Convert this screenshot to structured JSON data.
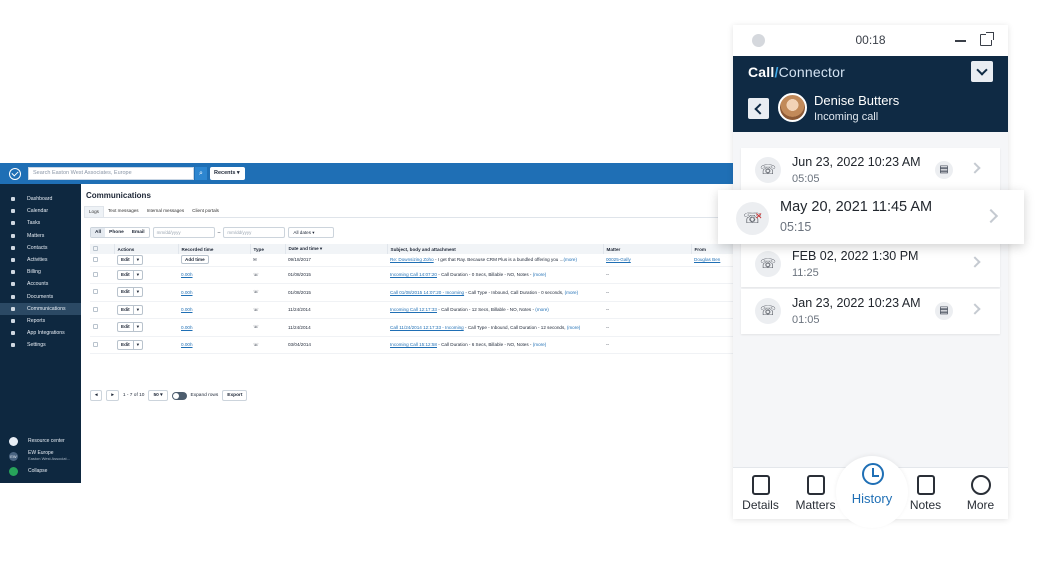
{
  "app": {
    "search_placeholder": "Search Easton West Associates, Europe",
    "recents_label": "Recents ▾",
    "sidebar": [
      {
        "label": "Dashboard"
      },
      {
        "label": "Calendar"
      },
      {
        "label": "Tasks"
      },
      {
        "label": "Matters"
      },
      {
        "label": "Contacts"
      },
      {
        "label": "Activities"
      },
      {
        "label": "Billing"
      },
      {
        "label": "Accounts"
      },
      {
        "label": "Documents"
      },
      {
        "label": "Communications",
        "active": true
      },
      {
        "label": "Reports"
      },
      {
        "label": "App Integrations"
      },
      {
        "label": "Settings"
      }
    ],
    "sidebar_bottom": {
      "resource_center": "Resource center",
      "org_initials": "EW",
      "org_name": "EW Europe",
      "org_sub": "Easton West Associat...",
      "collapse": "Collapse"
    },
    "page_title": "Communications",
    "tabs": [
      "Logs",
      "Text messages",
      "Internal messages",
      "Client portals"
    ],
    "filters": {
      "all": "All",
      "phone": "Phone",
      "email": "Email",
      "date_placeholder": "mm/dd/yyyy",
      "dash": "–",
      "dates_select": "All dates ▾"
    },
    "columns": [
      "Actions",
      "Recorded time",
      "Type",
      "Date and time ▾",
      "Subject, body and attachment",
      "Matter",
      "From"
    ],
    "rows": [
      {
        "action": "Edit",
        "recorded": "Add time",
        "type": "✉",
        "date": "09/18/2017",
        "subject_link": "Re: Downsizing Zoho",
        "subject_text": " - I get that Ray. Because CRM Plus is a bundled offering you ...",
        "more": "(more)",
        "matter": "00025-Gally",
        "from": "Douglas Ben"
      },
      {
        "action": "Edit",
        "recorded": "0.00h",
        "type": "☏",
        "date": "01/08/2015",
        "subject_link": "Incoming Call 14:07:20",
        "subject_text": " - Call Duration - 0 Secs, Billable - NO, Notes - ",
        "more": "(more)",
        "matter": "--",
        "from": ""
      },
      {
        "action": "Edit",
        "recorded": "0.00h",
        "type": "☏",
        "date": "01/08/2015",
        "subject_link": "Call 01/08/2015 14:07:20 - Incoming",
        "subject_text": " - Call Type - Inbound, Call Duration - 0 seconds, ",
        "more": "(more)",
        "matter": "--",
        "from": ""
      },
      {
        "action": "Edit",
        "recorded": "0.00h",
        "type": "☏",
        "date": "11/24/2014",
        "subject_link": "Incoming Call 12:17:33",
        "subject_text": " - Call Duration - 12 Secs, Billable - NO, Notes - ",
        "more": "(more)",
        "matter": "--",
        "from": ""
      },
      {
        "action": "Edit",
        "recorded": "0.00h",
        "type": "☏",
        "date": "11/24/2014",
        "subject_link": "Call 11/24/2014 12:17:33 - Incoming",
        "subject_text": " - Call Type - Inbound, Call Duration - 12 seconds, ",
        "more": "(more)",
        "matter": "--",
        "from": ""
      },
      {
        "action": "Edit",
        "recorded": "0.00h",
        "type": "☏",
        "date": "03/04/2014",
        "subject_link": "Incoming Call 15:12:58",
        "subject_text": " - Call Duration - 6 Secs, Billable - NO, Notes - ",
        "more": "(more)",
        "matter": "--",
        "from": ""
      }
    ],
    "pager": {
      "range": "1 - 7 of 10",
      "per_page": "50 ▾",
      "expand": "Expand rows",
      "export": "Export"
    }
  },
  "widget": {
    "timer": "00:18",
    "brand_call": "Call",
    "brand_slash": "/",
    "brand_connector": "Connector",
    "caller_name": "Denise Butters",
    "call_status": "Incoming call",
    "entries": [
      {
        "date": "Jun 23, 2022 10:23 AM",
        "duration": "05:05",
        "icon": "incoming-call",
        "note": true
      },
      {
        "date": "May 20, 2021 11:45 AM",
        "duration": "05:15",
        "icon": "missed-call",
        "note": false
      },
      {
        "date": "FEB 02, 2022 1:30 PM",
        "duration": "11:25",
        "icon": "outgoing-call",
        "note": false
      },
      {
        "date": "Jan 23, 2022 10:23 AM",
        "duration": "01:05",
        "icon": "incoming-call",
        "note": true
      }
    ],
    "nav": [
      {
        "label": "Details",
        "icon": "contact-card-icon"
      },
      {
        "label": "Matters",
        "icon": "document-icon"
      },
      {
        "label": "History",
        "icon": "history-icon",
        "active": true
      },
      {
        "label": "Notes",
        "icon": "notes-icon"
      },
      {
        "label": "More",
        "icon": "more-icon"
      }
    ]
  },
  "colors": {
    "accent": "#1f6fb5",
    "header": "#0f2a44",
    "sidebar": "#0e2840"
  }
}
